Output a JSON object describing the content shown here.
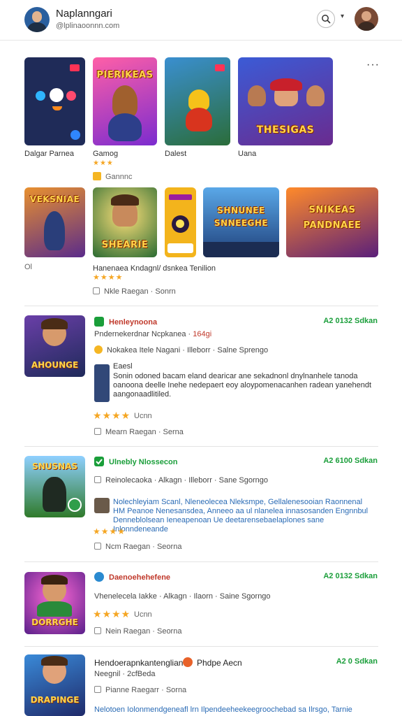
{
  "header": {
    "name": "Naplanngari",
    "handle": "@lplinaoonnn.com",
    "search_icon": "search-icon",
    "chevron_icon": "chevron-down-icon"
  },
  "row1": {
    "tiles": [
      {
        "title_art": "",
        "caption": "Dalgar Parnea"
      },
      {
        "title_art": "PIERIKEAS",
        "caption": "Gamog"
      },
      {
        "title_art": "",
        "caption": "Dalest"
      },
      {
        "title_art": "THESIGAS",
        "caption": "Uana"
      }
    ],
    "badge_text": "Gannnc"
  },
  "row2": {
    "tiles": [
      {
        "title_art": "VEKSNIAE"
      },
      {
        "title_art": "SHEARIE"
      },
      {
        "title_art": ""
      },
      {
        "title_art": "SHNUNEE SNNEEGHE"
      },
      {
        "title_art": "SNIKEAS PANDNAEE"
      }
    ],
    "left_caption": "Ol",
    "headline": "Hanenaea Kndagnl/ dsnkea Tenilion",
    "meta": "Nkle   Raegan  ·  Sonrn"
  },
  "cards": [
    {
      "title": "Henleynoona",
      "price": "A2 0132 Sdkan",
      "thumb_title": "AHOUNGE",
      "line1": "Pndernekerdnar  Ncpkanea  ·",
      "line1_accent": "164gi",
      "line2": "Nokakea  Itele  Nagani  ·  Illeborr  ·  Salne  Sprengo",
      "mini_label": "Eaesl",
      "desc": "Sonin odoned bacam eland dearicar ane sekadnonl dnylnanhele tanoda oanoona deelle Inehe nedepaert eoy aloypomenacanhen radean yanehendt aangonaadlitiled.",
      "rating_text": "Ucnn",
      "meta": "Mearn  Raegan  ·  Serna"
    },
    {
      "title": "Ulnebly Nlossecon",
      "price": "A2 6100 Sdkan",
      "thumb_title": "SNUSNAS",
      "line1": "Reinolecaoka  ·  Alkagn  ·  Illeborr  ·  Sane Sgorngo",
      "desc": "Nolechleyiam Scanl, Nleneolecea Nleksmpe, Gellalenesooian Raonnenal HM Peanoe Nenesansdea, Anneeo aa ul nlanelea innasosanden Engnnbul Denneblolsean Ieneapenoan Ue deetarensebaelaplones sane Inlonndeneande",
      "meta": "Ncm  Raegan  ·  Seorna"
    },
    {
      "title": "Daenoehehefene",
      "price": "A2 0132 Sdkan",
      "thumb_title": "DORRGHE",
      "line1": "Vhenelecela Iakke  ·  Alkagn  ·  Ilaorn  ·  Saine Sgorngo",
      "rating_text": "Ucnn",
      "meta": "Nein  Raegan  ·  Seorna"
    },
    {
      "title": "Hendoerapnkantenglian",
      "title2": "Phdpe Aecn",
      "price": "A2 0 Sdkan",
      "thumb_title": "DRAPINGE",
      "line1": "Neegnil  ·  2cfBeda",
      "meta": "Pianne  Raegarr  ·  Sorna",
      "desc": "Nelotoen Iolonmendgeneafl lrn Ilpendeeheekeegroochebad sa Ilrsgo, Tarnie"
    }
  ],
  "colors": {
    "accent_red": "#c0392b",
    "price_green": "#1a9e3a",
    "link_blue": "#2a6bb5",
    "star_gold": "#f5a623"
  }
}
